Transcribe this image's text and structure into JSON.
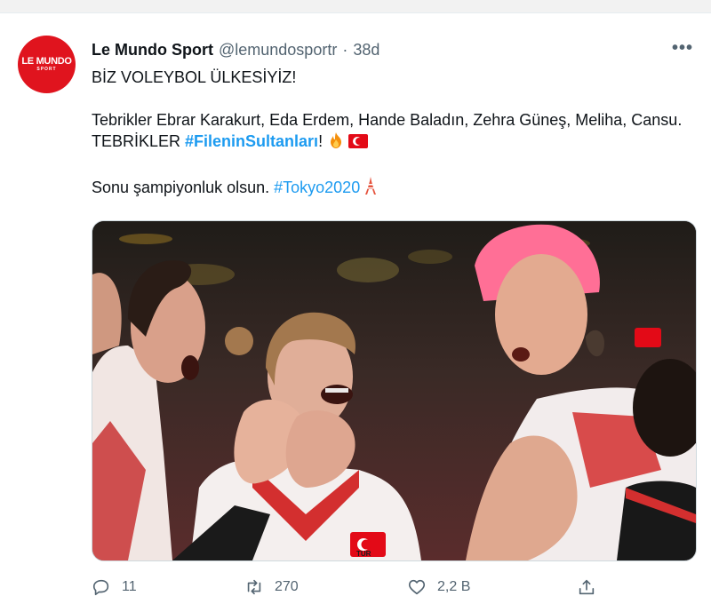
{
  "tweet": {
    "author": {
      "display_name": "Le Mundo Sport",
      "handle": "@lemundosportr",
      "separator": "·",
      "time": "38d",
      "avatar_text": "LE MUNDO",
      "avatar_subtext": "SPORT"
    },
    "more_label": "•••",
    "text": {
      "line1": "BİZ VOLEYBOL ÜLKESİYİZ!",
      "line2": "Tebrikler Ebrar Karakurt, Eda Erdem, Hande Baladın, Zehra Güneş, Meliha, Cansu. TEBRİKLER ",
      "hashtag1": "#FileninSultanları",
      "line2_end": "!",
      "line3": "Sonu şampiyonluk olsun. ",
      "hashtag2": "#Tokyo2020"
    },
    "media": {
      "jersey_text": "TUR"
    },
    "actions": {
      "replies": "11",
      "retweets": "270",
      "likes": "2,2 B"
    }
  },
  "colors": {
    "accent": "#1d9bf0",
    "brand_red": "#e0141e",
    "muted": "#536471"
  }
}
